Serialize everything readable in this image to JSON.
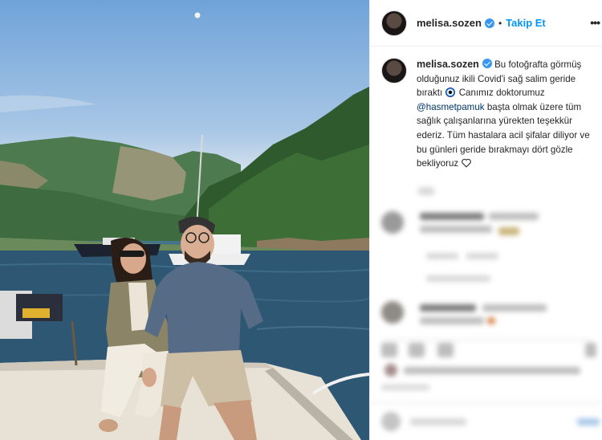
{
  "post": {
    "username": "melisa.sozen",
    "follow_label": "Takip Et",
    "separator": "•",
    "more_label": "•••"
  },
  "caption": {
    "username": "melisa.sozen",
    "text_1": "Bu fotoğrafta görmüş olduğunuz ikili Covid'i sağ salim geride bıraktı",
    "text_2": "Canımız doktorumuz",
    "mention": "@hasmetpamuk",
    "text_3": "başta olmak üzere tüm sağlık çalışanlarına yürekten teşekkür ederiz. Tüm hastalara acil şifalar diliyor ve bu günleri geride bırakmayı dört gözle bekliyoruz"
  },
  "colors": {
    "link_blue": "#0095f6",
    "verified_blue": "#3897f0",
    "text": "#262626",
    "mention": "#00376b"
  },
  "icons": [
    "verified-badge-icon",
    "more-options-icon",
    "nazar-boncugu-icon",
    "heart-outline-icon"
  ]
}
